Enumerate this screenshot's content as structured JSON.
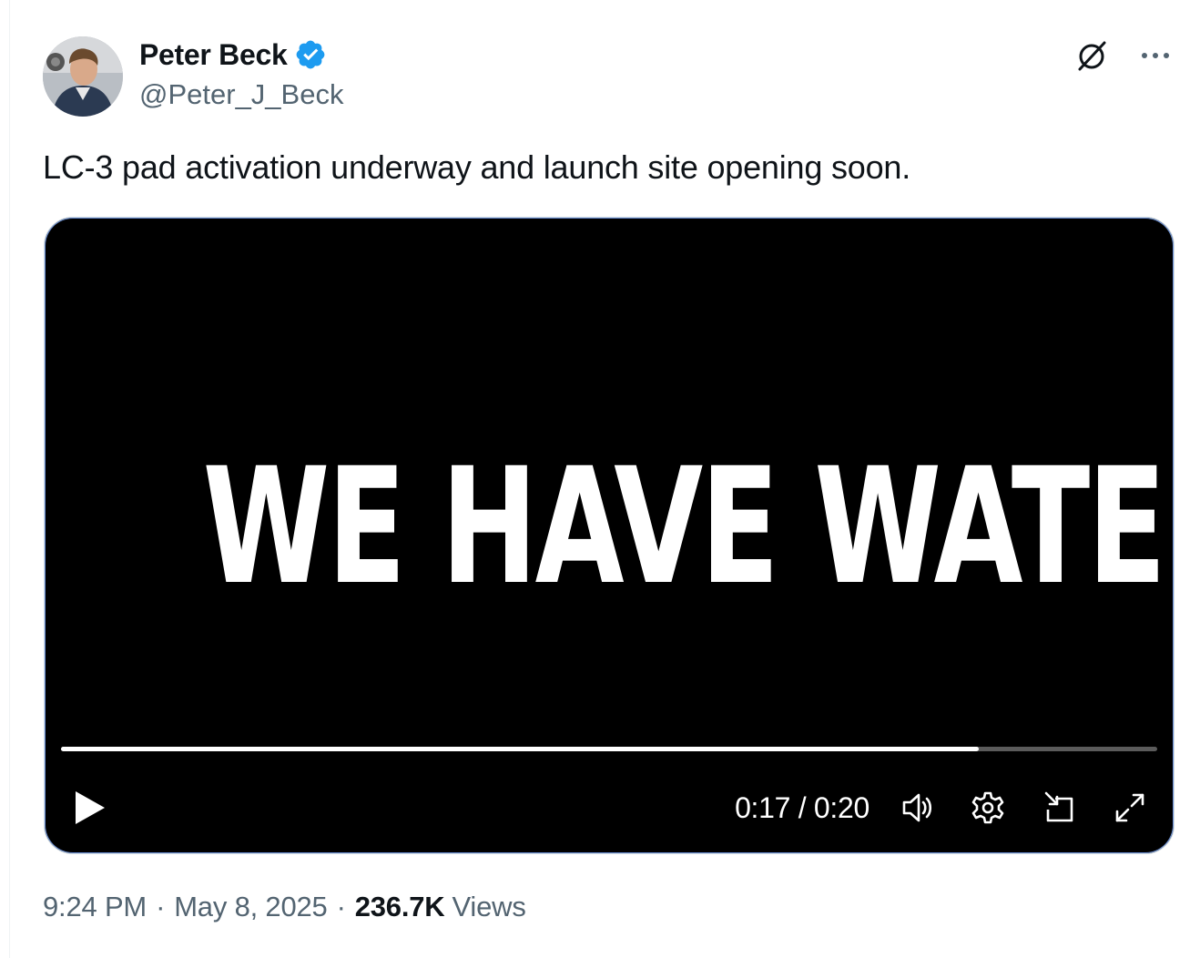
{
  "author": {
    "display_name": "Peter Beck",
    "handle": "@Peter_J_Beck",
    "verified": true,
    "verified_color": "#1d9bf0"
  },
  "header_actions": {
    "grok_icon": "grok-slash-circle-icon",
    "more_icon": "more-horizontal-icon"
  },
  "tweet": {
    "text": "LC-3 pad activation underway and launch site opening soon."
  },
  "video": {
    "caption": "WE HAVE WATER",
    "time_display": "0:17 / 0:20",
    "current_time": "0:17",
    "duration": "0:20",
    "progress_fraction": 0.837,
    "controls": [
      "play-icon",
      "volume-icon",
      "settings-icon",
      "pip-icon",
      "fullscreen-icon"
    ]
  },
  "footer": {
    "time": "9:24 PM",
    "date": "May 8, 2025",
    "separator": "·",
    "views_count": "236.7K",
    "views_label": "Views"
  }
}
